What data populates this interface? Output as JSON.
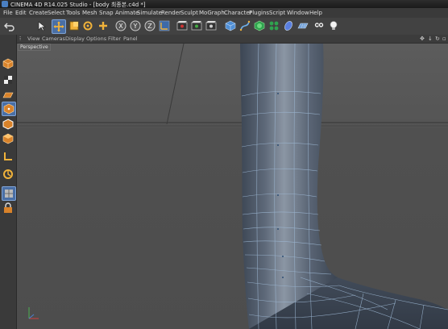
{
  "window": {
    "title": "CINEMA 4D R14.025 Studio - [body 최종본.c4d *]"
  },
  "menu": {
    "items": [
      "File",
      "Edit",
      "Create",
      "Select",
      "Tools",
      "Mesh",
      "Snap",
      "Animate",
      "Simulate",
      "Render",
      "Sculpt",
      "MoGraph",
      "Character",
      "Plugins",
      "Script",
      "Window",
      "Help"
    ]
  },
  "toolbar": {
    "icons": [
      "undo-icon",
      "live-selection-icon",
      "move-icon",
      "scale-icon",
      "rotate-icon",
      "add-object-icon",
      "x-axis-lock-icon",
      "y-axis-lock-icon",
      "z-axis-lock-icon",
      "coordinate-system-icon",
      "render-view-icon",
      "render-to-picture-viewer-icon",
      "edit-render-settings-icon",
      "cube-icon",
      "pen-icon",
      "subdivision-icon",
      "array-icon",
      "deformer-icon",
      "floor-icon",
      "camera-icon",
      "light-icon"
    ],
    "axis_x": "X",
    "axis_y": "Y",
    "axis_z": "Z"
  },
  "viewport_menu": {
    "items": [
      "View",
      "Cameras",
      "Display",
      "Options",
      "Filter",
      "Panel"
    ]
  },
  "viewport": {
    "label": "Perspective"
  },
  "colors": {
    "mesh_base": "#5b6b80",
    "mesh_wire": "#9fbad6",
    "accent": "#3d7fd1"
  }
}
